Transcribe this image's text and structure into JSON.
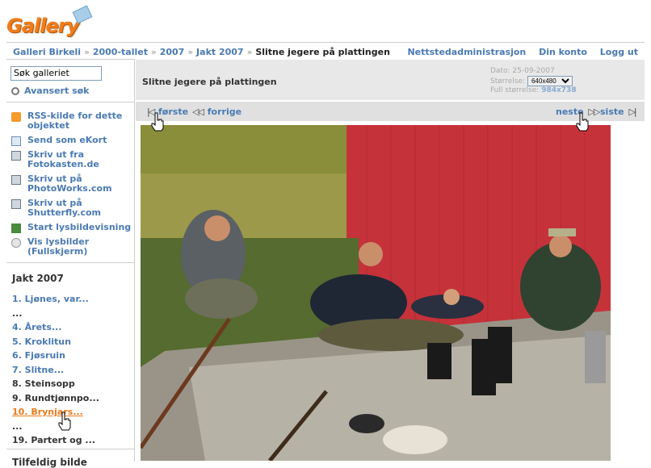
{
  "logo": {
    "text": "Gallery"
  },
  "breadcrumb": [
    "Galleri Birkeli",
    "2000-tallet",
    "2007",
    "Jakt 2007"
  ],
  "breadcrumb_current": "Slitne jegere på plattingen",
  "breadcrumb_sep": "»",
  "site_links": {
    "admin": "Nettstedadministrasjon",
    "account": "Din konto",
    "logout": "Logg ut"
  },
  "search": {
    "placeholder": "Søk galleriet",
    "advanced": "Avansert søk"
  },
  "actions": [
    {
      "label": "RSS-kilde for dette objektet",
      "icon": "rss-icon"
    },
    {
      "label": "Send som eKort",
      "icon": "ecard-icon"
    },
    {
      "label": "Skriv ut fra Fotokasten.de",
      "icon": "print-icon"
    },
    {
      "label": "Skriv ut på PhotoWorks.com",
      "icon": "print-icon"
    },
    {
      "label": "Skriv ut på Shutterfly.com",
      "icon": "print-icon"
    },
    {
      "label": "Start lysbildevisning",
      "icon": "slideshow-icon"
    },
    {
      "label": "Vis lysbilder (Fullskjerm)",
      "icon": "fullscreen-slideshow-icon"
    }
  ],
  "album": {
    "title": "Jakt 2007",
    "items": [
      {
        "label": "1. Ljønes, var...",
        "state": "link"
      },
      {
        "label": "...",
        "state": "current"
      },
      {
        "label": "4. Årets...",
        "state": "link"
      },
      {
        "label": "5. Kroklitun",
        "state": "link"
      },
      {
        "label": "6. Fjøsruin",
        "state": "link"
      },
      {
        "label": "7. Slitne...",
        "state": "link"
      },
      {
        "label": "8. Steinsopp",
        "state": "current"
      },
      {
        "label": "9. Rundtjønnpo...",
        "state": "current"
      },
      {
        "label": "10. Brynjars...",
        "state": "hover"
      },
      {
        "label": "...",
        "state": "current"
      },
      {
        "label": "19. Partert og ...",
        "state": "current"
      }
    ],
    "more": "Tilfeldig bilde"
  },
  "photo_header": {
    "title": "Slitne jegere på plattingen",
    "date_label": "Dato:",
    "date": "25-09-2007",
    "size_label": "Størrelse:",
    "size_value": "640x480",
    "full_label": "Full størrelse:",
    "full_value": "984x738"
  },
  "nav": {
    "first": "første",
    "prev": "forrige",
    "next": "neste",
    "last": "siste"
  },
  "colors": {
    "link": "#4a7ab3",
    "hover": "#e87a1c",
    "header_bg": "#e8e8e8",
    "logo": "#f07d1a"
  }
}
